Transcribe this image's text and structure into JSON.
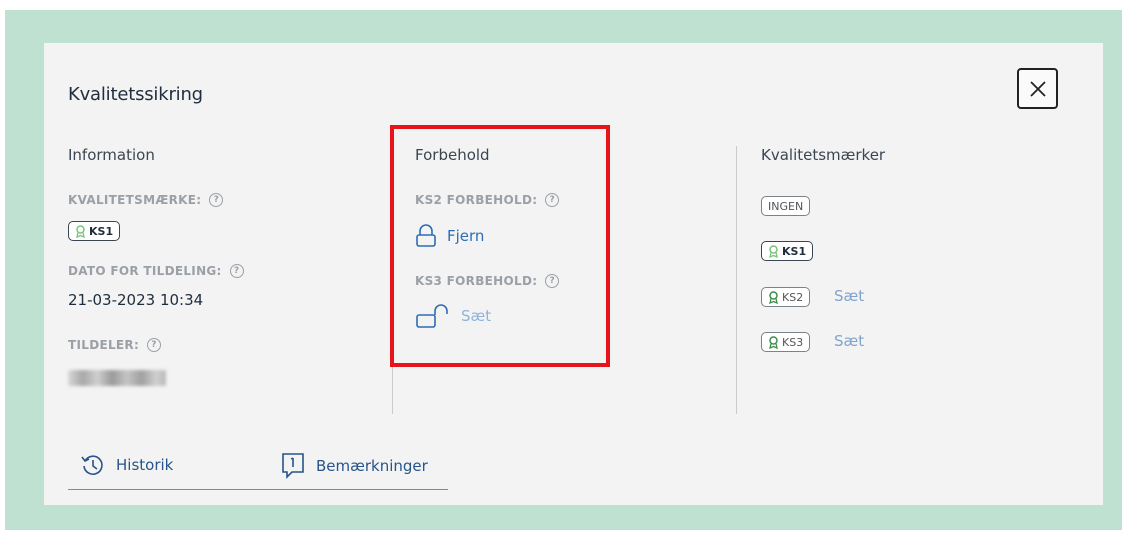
{
  "dialog": {
    "title": "Kvalitetssikring"
  },
  "information": {
    "heading": "Information",
    "quality_label": "KVALITETSMÆRKE:",
    "quality_badge": "KS1",
    "date_label": "DATO FOR TILDELING:",
    "date_value": "21-03-2023 10:34",
    "assigner_label": "TILDELER:"
  },
  "reservations": {
    "heading": "Forbehold",
    "ks2_label": "KS2 FORBEHOLD:",
    "ks2_action": "Fjern",
    "ks3_label": "KS3 FORBEHOLD:",
    "ks3_action": "Sæt"
  },
  "quality_marks": {
    "heading": "Kvalitetsmærker",
    "items": [
      {
        "badge": "INGEN"
      },
      {
        "badge": "KS1"
      },
      {
        "badge": "KS2",
        "action": "Sæt"
      },
      {
        "badge": "KS3",
        "action": "Sæt"
      }
    ]
  },
  "tabs": [
    {
      "label": "Historik"
    },
    {
      "label": "Bemærkninger"
    }
  ],
  "help_glyph": "?",
  "colors": {
    "frame_bg": "#bfe1d2",
    "dialog_bg": "#f3f3f3",
    "highlight": "#e8141b",
    "link": "#2d6db3",
    "badge_green": "#7cc37a"
  }
}
